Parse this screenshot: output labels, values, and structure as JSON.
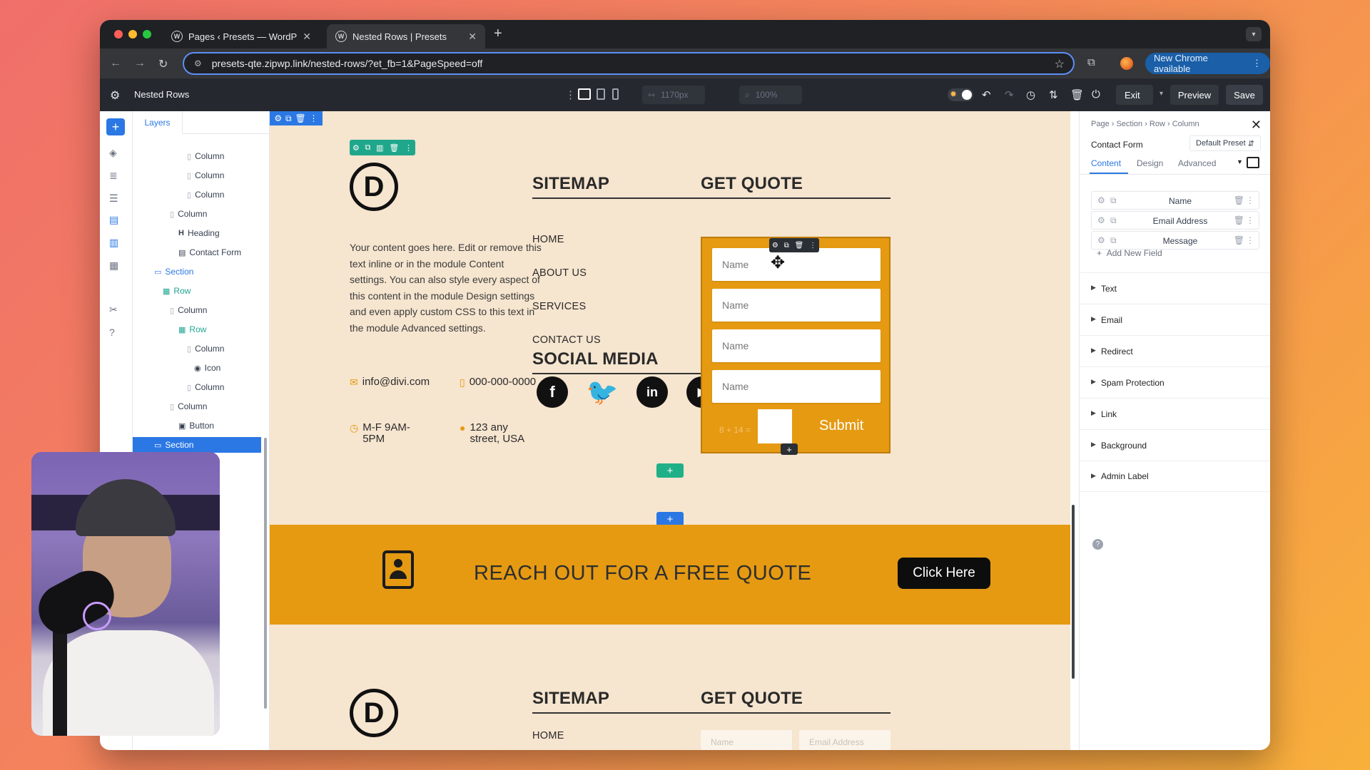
{
  "browser": {
    "tabs": [
      {
        "title": "Pages ‹ Presets — WordPress",
        "active": false
      },
      {
        "title": "Nested Rows | Presets",
        "active": true
      }
    ],
    "url": "presets-qte.zipwp.link/nested-rows/?et_fb=1&PageSpeed=off",
    "update_label": "New Chrome available"
  },
  "builder": {
    "page_name": "Nested Rows",
    "width_value": "1170px",
    "zoom_value": "100%",
    "exit_label": "Exit",
    "preview_label": "Preview",
    "save_label": "Save"
  },
  "layers": {
    "tab_label": "Layers",
    "items": [
      {
        "label": "Column",
        "type": "column",
        "depth": 3
      },
      {
        "label": "Column",
        "type": "column",
        "depth": 3
      },
      {
        "label": "Column",
        "type": "column",
        "depth": 3
      },
      {
        "label": "Column",
        "type": "column",
        "depth": 2
      },
      {
        "label": "Heading",
        "type": "heading",
        "depth": 3
      },
      {
        "label": "Contact Form",
        "type": "form",
        "depth": 3
      },
      {
        "label": "Section",
        "type": "section",
        "depth": 0
      },
      {
        "label": "Row",
        "type": "row",
        "depth": 1
      },
      {
        "label": "Column",
        "type": "column",
        "depth": 2
      },
      {
        "label": "Row",
        "type": "row",
        "depth": 3
      },
      {
        "label": "Column",
        "type": "column",
        "depth": 4
      },
      {
        "label": "Icon",
        "type": "icon",
        "depth": 5
      },
      {
        "label": "Column",
        "type": "column",
        "depth": 4
      },
      {
        "label": "Column",
        "type": "column",
        "depth": 2
      },
      {
        "label": "Button",
        "type": "button",
        "depth": 3
      },
      {
        "label": "Section",
        "type": "section",
        "depth": 0,
        "selected": true
      }
    ]
  },
  "page": {
    "logo_letter": "D",
    "body_text": "Your content goes here. Edit or remove this text inline or in the module Content settings. You can also style every aspect of this content in the module Design settings and even apply custom CSS to this text in the module Advanced settings.",
    "email": "info@divi.com",
    "phone": "000-000-0000",
    "hours": "M-F 9AM-5PM",
    "address": "123 any street, USA",
    "sitemap_heading": "SITEMAP",
    "nav_links": [
      "HOME",
      "ABOUT US",
      "SERVICES",
      "CONTACT US"
    ],
    "social_heading": "SOCIAL MEDIA",
    "social_icons": [
      "facebook-icon",
      "twitter-icon",
      "linkedin-icon",
      "youtube-icon"
    ],
    "quote_heading": "GET QUOTE",
    "form_placeholders": [
      "Name",
      "Name",
      "Name",
      "Name"
    ],
    "captcha": "8 + 14 =",
    "submit_label": "Submit",
    "banner_text": "REACH OUT FOR A FREE QUOTE",
    "banner_button": "Click Here",
    "repeat_home": "HOME",
    "ghost_name": "Name",
    "ghost_email": "Email Address",
    "accent_color": "#e59a12",
    "page_background": "#f6e5cf"
  },
  "settings": {
    "breadcrumb": "Page › Section › Row › Column",
    "module_title": "Contact Form",
    "preset_label": "Default Preset",
    "tabs": [
      "Content",
      "Design",
      "Advanced"
    ],
    "active_tab": "Content",
    "fields": [
      "Name",
      "Email Address",
      "Message"
    ],
    "add_field_label": "Add New Field",
    "toggles": [
      "Text",
      "Email",
      "Redirect",
      "Spam Protection",
      "Link",
      "Background",
      "Admin Label"
    ]
  }
}
